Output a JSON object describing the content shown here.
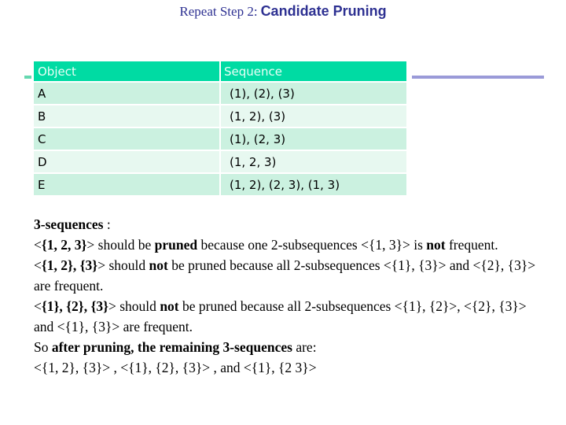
{
  "title": {
    "prefix": "Repeat Step 2:",
    "main": "Candidate Pruning"
  },
  "table": {
    "headers": [
      "Object",
      "Sequence"
    ],
    "rows": [
      {
        "object": "A",
        "sequence": "(1), (2), (3)"
      },
      {
        "object": "B",
        "sequence": "(1, 2), (3)"
      },
      {
        "object": "C",
        "sequence": "(1), (2, 3)"
      },
      {
        "object": "D",
        "sequence": "(1, 2, 3)"
      },
      {
        "object": "E",
        "sequence": "(1, 2), (2, 3), (1, 3)"
      }
    ]
  },
  "colors": {
    "title": "#2e3192",
    "header_bg": "#00dba3",
    "row_odd": "#cbf1e0",
    "row_even": "#e7f8f0",
    "rule": "#9a9ad8"
  },
  "explanation": {
    "heading": "3-sequences",
    "heading_suffix": " :",
    "p1": {
      "open": "<",
      "seq": "{1, 2, 3}",
      "close": ">",
      "t1": " should be ",
      "b1": "pruned",
      "t2": " because one 2-subsequences <{1, 3}> is ",
      "b2": "not",
      "t3": " frequent."
    },
    "p2": {
      "open": "<",
      "seq": "{1, 2}, {3}",
      "close": ">",
      "t1": " should ",
      "b1": "not",
      "t2": " be pruned because all 2-subsequences <{1}, {3}> and <{2}, {3}> are frequent."
    },
    "p3": {
      "open": "<",
      "seq": "{1}, {2}, {3}",
      "close": ">",
      "t1": " should ",
      "b1": "not",
      "t2": " be pruned because all 2-subsequences <{1}, {2}>, <{2}, {3}> and <{1}, {3}> are frequent."
    },
    "p4": {
      "t1": "So ",
      "b1": "after pruning, the remaining 3-sequences",
      "t2": " are:"
    },
    "p5": "<{1, 2}, {3}> , <{1}, {2}, {3}> , and <{1}, {2 3}>"
  }
}
